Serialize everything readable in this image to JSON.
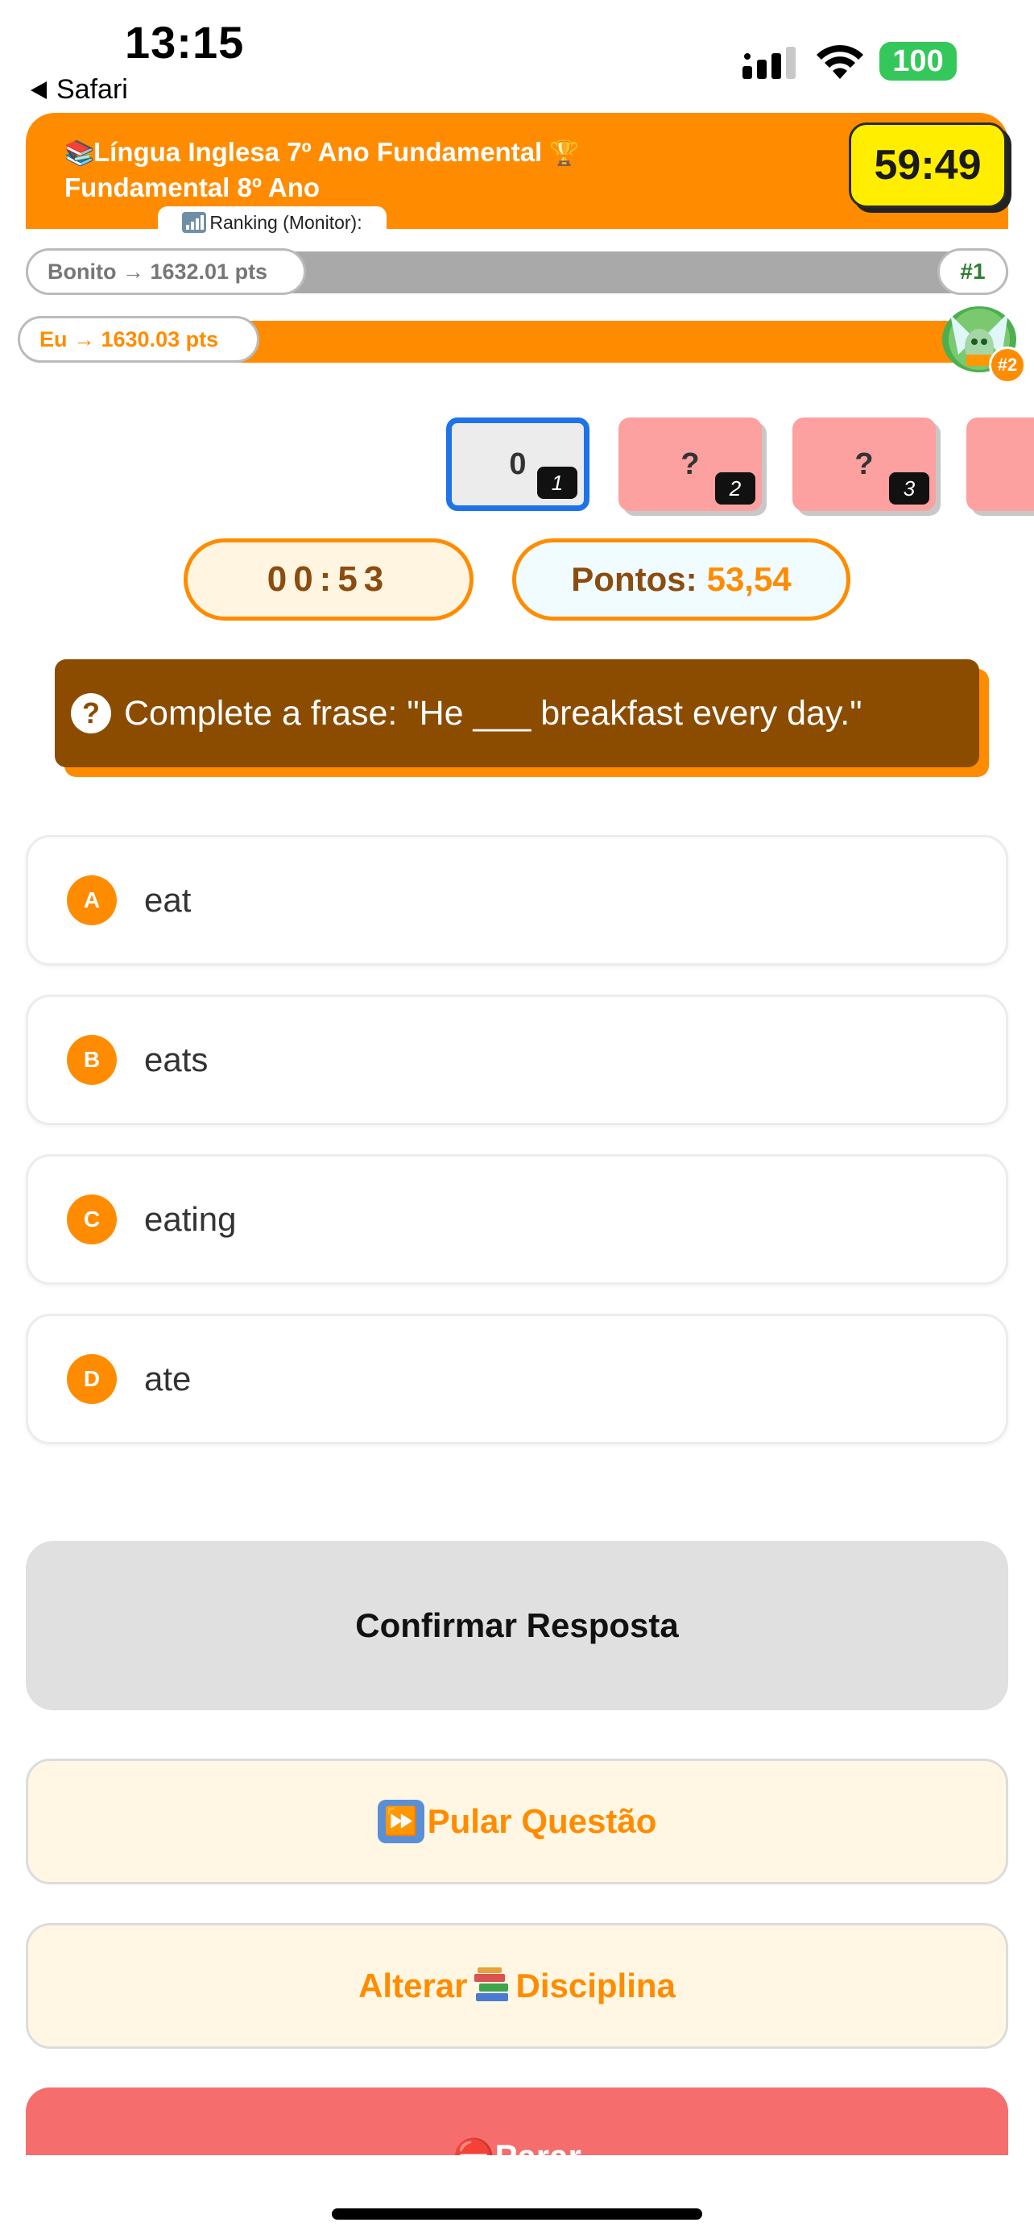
{
  "status_bar": {
    "time": "13:15",
    "back_label": "Safari",
    "battery": "100"
  },
  "header": {
    "title_line1": "Língua Inglesa 7º Ano Fundamental",
    "title_line2": "Fundamental 8º Ano",
    "timer": "59:49",
    "ranking_tab": "Ranking (Monitor):"
  },
  "ranking": {
    "first": {
      "label": "Bonito → 1632.01 pts",
      "rank": "#1",
      "progress": 1.0
    },
    "me": {
      "label": "Eu → 1630.03 pts",
      "rank": "#2",
      "progress": 0.999
    }
  },
  "question_nav": [
    {
      "label": "0",
      "number": "1",
      "state": "current"
    },
    {
      "label": "?",
      "number": "2",
      "state": "unanswered"
    },
    {
      "label": "?",
      "number": "3",
      "state": "unanswered"
    },
    {
      "label": "?",
      "number": "",
      "state": "unanswered"
    }
  ],
  "stats": {
    "countdown": "00:53",
    "points_label": "Pontos:",
    "points_value": "53,54"
  },
  "question": {
    "icon": "?",
    "text": "Complete a frase: \"He ___ breakfast every day.\""
  },
  "options": [
    {
      "letter": "A",
      "text": "eat"
    },
    {
      "letter": "B",
      "text": "eats"
    },
    {
      "letter": "C",
      "text": "eating"
    },
    {
      "letter": "D",
      "text": "ate"
    }
  ],
  "buttons": {
    "confirm": "Confirmar Resposta",
    "skip": "Pular Questão",
    "change_prefix": "Alterar",
    "change_suffix": "Disciplina",
    "stop": "Parar"
  },
  "colors": {
    "accent": "#ff8c00",
    "question_bg": "#8b4c00",
    "timer_bg": "#ffee00",
    "current_border": "#1e73e8",
    "unanswered_bg": "#fca0a0",
    "stop_bg": "#f66d6d"
  },
  "icons": {
    "header_left": "books-icon",
    "header_right": "trophy-icon",
    "skip": "fast-forward-icon",
    "change": "books-icon",
    "stop": "no-entry-icon"
  }
}
